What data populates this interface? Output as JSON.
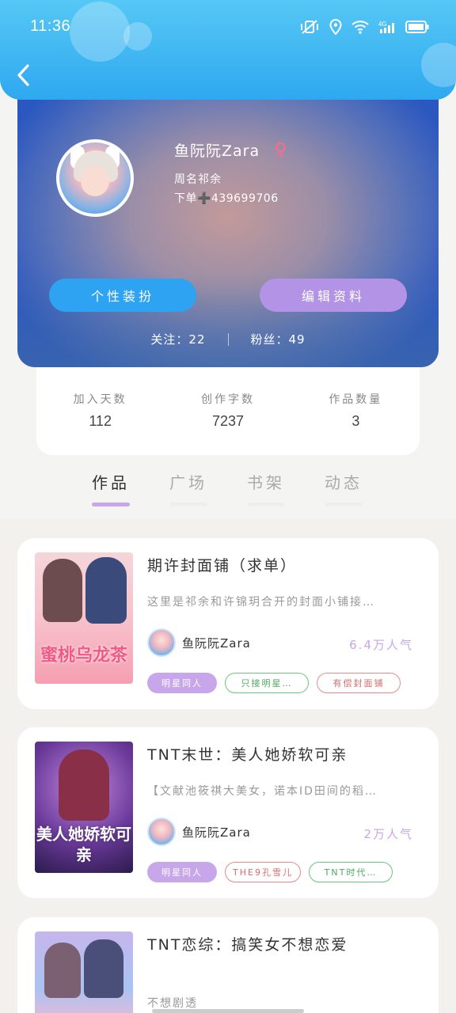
{
  "status_bar": {
    "time": "11:36",
    "network": "4G"
  },
  "profile": {
    "name": "鱼阮阮Zara",
    "gender_symbol": "♀",
    "line1": "周名祁余",
    "line2": "下单➕439699706",
    "btn_style": "个性装扮",
    "btn_edit": "编辑资料",
    "following_label": "关注：",
    "following_value": "22",
    "fans_label": "粉丝：",
    "fans_value": "49"
  },
  "stats": [
    {
      "label": "加入天数",
      "value": "112"
    },
    {
      "label": "创作字数",
      "value": "7237"
    },
    {
      "label": "作品数量",
      "value": "3"
    }
  ],
  "tabs": [
    {
      "label": "作品",
      "active": true
    },
    {
      "label": "广场",
      "active": false
    },
    {
      "label": "书架",
      "active": false
    },
    {
      "label": "动态",
      "active": false
    }
  ],
  "works": [
    {
      "title": "期许封面铺（求单）",
      "desc": "这里是祁余和许锦玥合开的封面小铺接…",
      "author": "鱼阮阮Zara",
      "popularity": "6.4万人气",
      "cover_text": "蜜桃乌龙茶",
      "tags": [
        {
          "label": "明星同人",
          "style": "purple"
        },
        {
          "label": "只接明星…",
          "style": "green"
        },
        {
          "label": "有偿封面铺",
          "style": "red"
        }
      ]
    },
    {
      "title": "TNT末世：美人她娇软可亲",
      "desc": "【文献池筱祺大美女，诺本ID田间的稻…",
      "author": "鱼阮阮Zara",
      "popularity": "2万人气",
      "cover_text": "美人她娇软可亲",
      "tags": [
        {
          "label": "明星同人",
          "style": "purple"
        },
        {
          "label": "THE9孔雪儿",
          "style": "red"
        },
        {
          "label": "TNT时代…",
          "style": "green"
        }
      ]
    },
    {
      "title": "TNT恋综：搞笑女不想恋爱",
      "desc": "不想剧透",
      "cover_text": ""
    }
  ],
  "colors": {
    "header": "#2ea8f0",
    "accent_purple": "#c7a7ea",
    "btn_blue": "#2ea3f1"
  }
}
